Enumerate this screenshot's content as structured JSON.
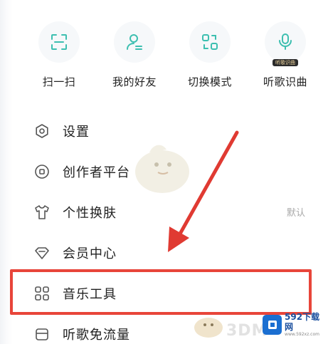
{
  "quick_actions": [
    {
      "label": "扫一扫",
      "icon": "scan-icon"
    },
    {
      "label": "我的好友",
      "icon": "friend-icon"
    },
    {
      "label": "切换模式",
      "icon": "switch-mode-icon"
    },
    {
      "label": "听歌识曲",
      "icon": "mic-icon",
      "badge": "听歌识曲"
    }
  ],
  "menu": [
    {
      "label": "设置",
      "icon": "settings-icon"
    },
    {
      "label": "创作者平台",
      "icon": "creator-icon"
    },
    {
      "label": "个性换肤",
      "icon": "shirt-icon",
      "value": "默认"
    },
    {
      "label": "会员中心",
      "icon": "diamond-icon"
    },
    {
      "label": "音乐工具",
      "icon": "grid-icon"
    },
    {
      "label": "听歌免流量",
      "icon": "sim-icon"
    }
  ],
  "watermark": {
    "text": "3DM",
    "logo_main": "592下载网",
    "logo_sub": "www.592xz.com"
  },
  "colors": {
    "accent": "#3dbfb0",
    "highlight": "#e8453a"
  }
}
